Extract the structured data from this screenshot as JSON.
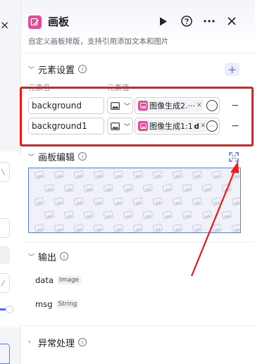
{
  "left_panel": {
    "close_glyph": "×"
  },
  "header": {
    "title": "画板",
    "description": "自定义画板排版，支持引用添加文本和图片",
    "node_icon": "edit-pen-icon",
    "run_icon": "play-icon",
    "help_icon": "question-circle-icon",
    "more_icon": "more-horizontal-icon",
    "close_icon": "close-icon",
    "brand_color": "#e8489a"
  },
  "element_settings": {
    "title": "元素设置",
    "add_label": "+",
    "col_name": "元素名",
    "col_value": "元素值",
    "rows": [
      {
        "name": "background",
        "value": "图像生成2.···",
        "value_suffix": ""
      },
      {
        "name": "background1",
        "value": "图像生成1:1 ·",
        "value_suffix": "d"
      }
    ],
    "remove_label": "−"
  },
  "canvas_edit": {
    "title": "画板编辑",
    "accent_color": "#5f7cf7"
  },
  "output": {
    "title": "输出",
    "items": [
      {
        "name": "data",
        "type": "Image"
      },
      {
        "name": "msg",
        "type": "String"
      }
    ]
  },
  "error_handling": {
    "title": "异常处理"
  },
  "annotation": {
    "box_color": "#f21818"
  }
}
